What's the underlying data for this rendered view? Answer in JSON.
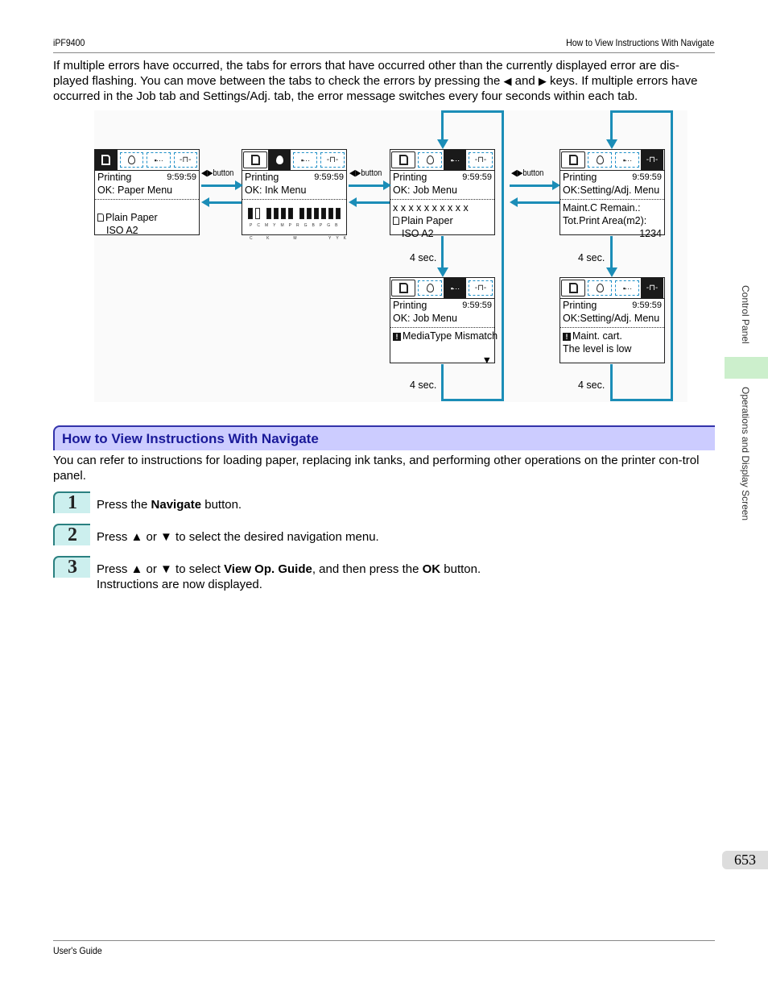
{
  "header": {
    "left": "iPF9400",
    "right": "How to View Instructions With Navigate"
  },
  "intro": {
    "part1": "If multiple errors have occurred, the tabs for errors that have occurred other than the currently displayed error are dis-played flashing. You can move between the tabs to check the errors by pressing the ",
    "left_key": "◀",
    "and": " and ",
    "right_key": "▶",
    "part2": " keys. If multiple errors have occurred in the Job tab and Settings/Adj. tab, the error message switches every four seconds within each tab."
  },
  "diagram": {
    "button_label": "◀▶button",
    "sec_label": "4 sec.",
    "accent_color": "#1b8db7",
    "screens": [
      {
        "id": "paper",
        "status": "Printing",
        "time": "9:59:59",
        "menu": "OK: Paper Menu",
        "line1": "Plain Paper",
        "line2": "ISO A2"
      },
      {
        "id": "ink",
        "status": "Printing",
        "time": "9:59:59",
        "menu": "OK: Ink Menu",
        "ink_labels_top": [
          "P",
          "C",
          "M",
          "Y",
          "M",
          "P",
          "R",
          "G",
          "B",
          "P",
          "G",
          "B"
        ],
        "ink_labels_bottom": [
          "C",
          "",
          "K",
          "",
          "M",
          "",
          "",
          "",
          "",
          "Y",
          "Y",
          "K"
        ]
      },
      {
        "id": "job",
        "status": "Printing",
        "time": "9:59:59",
        "menu": "OK: Job Menu",
        "line0": "x x x x x x x x x x",
        "line1": "Plain Paper",
        "line2": "ISO A2"
      },
      {
        "id": "setting",
        "status": "Printing",
        "time": "9:59:59",
        "menu": "OK:Setting/Adj. Menu",
        "line1": "Maint.C Remain.:",
        "line2": "Tot.Print Area(m2):",
        "line3": "1234"
      },
      {
        "id": "job-error",
        "status": "Printing",
        "time": "9:59:59",
        "menu": "OK: Job Menu",
        "error": "MediaType Mismatch",
        "more": "▼"
      },
      {
        "id": "setting-error",
        "status": "Printing",
        "time": "9:59:59",
        "menu": "OK:Setting/Adj. Menu",
        "error": "Maint. cart.",
        "line2": "The level is low"
      }
    ]
  },
  "section": {
    "title": "How to View Instructions With Navigate",
    "paragraph": "You can refer to instructions for loading paper, replacing ink tanks, and performing other operations on the printer con-trol panel."
  },
  "steps": [
    {
      "num": "1",
      "pre": "Press the ",
      "bold": "Navigate",
      "post": " button.",
      "line2": ""
    },
    {
      "num": "2",
      "pre": "Press ▲ or ▼ to select the desired navigation menu.",
      "bold": "",
      "post": "",
      "line2": ""
    },
    {
      "num": "3",
      "pre": "Press ▲ or ▼ to select ",
      "bold": "View Op. Guide",
      "mid": ", and then press the ",
      "bold2": "OK",
      "post": " button.",
      "line2": "Instructions are now displayed."
    }
  ],
  "sidebar": {
    "chapter": "Control Panel",
    "section": "Operations and Display Screen"
  },
  "page_number": "653",
  "footer": "User's Guide"
}
